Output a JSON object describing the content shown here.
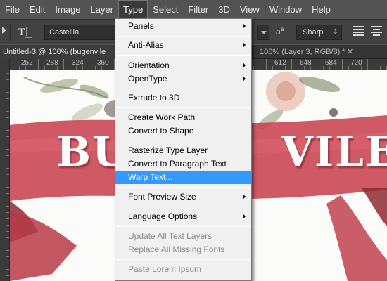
{
  "menubar": {
    "items": [
      "File",
      "Edit",
      "Image",
      "Layer",
      "Type",
      "Select",
      "Filter",
      "3D",
      "View",
      "Window",
      "Help"
    ],
    "active": "Type"
  },
  "options_bar": {
    "font_family": "Castellia",
    "antialias_symbol": "a",
    "antialias_value": "Sharp"
  },
  "document_tabs": [
    {
      "label": "Untitled-3 @ 100% (bugenvile",
      "active": true
    },
    {
      "label": "100% (Layer 3, RGB/8) *",
      "active": false
    }
  ],
  "ruler": {
    "top_labels": [
      "252",
      "288",
      "324",
      "360",
      "612",
      "648",
      "684",
      "720"
    ]
  },
  "canvas": {
    "text_left": "BU",
    "text_right": "VILE",
    "colors": {
      "ribbon": "#c8424f",
      "ribbon_dark": "#8e2a33",
      "leaf": "#6b7a52"
    }
  },
  "type_menu": {
    "items": [
      {
        "label": "Panels",
        "submenu": true,
        "enabled": true
      },
      {
        "label": "Anti-Alias",
        "submenu": true,
        "enabled": true
      },
      {
        "label": "Orientation",
        "submenu": true,
        "enabled": true
      },
      {
        "label": "OpenType",
        "submenu": true,
        "enabled": true
      },
      {
        "label": "Extrude to 3D",
        "submenu": false,
        "enabled": true
      },
      {
        "label": "Create Work Path",
        "submenu": false,
        "enabled": true
      },
      {
        "label": "Convert to Shape",
        "submenu": false,
        "enabled": true
      },
      {
        "label": "Rasterize Type Layer",
        "submenu": false,
        "enabled": true
      },
      {
        "label": "Convert to Paragraph Text",
        "submenu": false,
        "enabled": true
      },
      {
        "label": "Warp Text...",
        "submenu": false,
        "enabled": true,
        "highlighted": true
      },
      {
        "label": "Font Preview Size",
        "submenu": true,
        "enabled": true
      },
      {
        "label": "Language Options",
        "submenu": true,
        "enabled": true
      },
      {
        "label": "Update All Text Layers",
        "submenu": false,
        "enabled": false
      },
      {
        "label": "Replace All Missing Fonts",
        "submenu": false,
        "enabled": false
      },
      {
        "label": "Paste Lorem Ipsum",
        "submenu": false,
        "enabled": false
      }
    ]
  }
}
